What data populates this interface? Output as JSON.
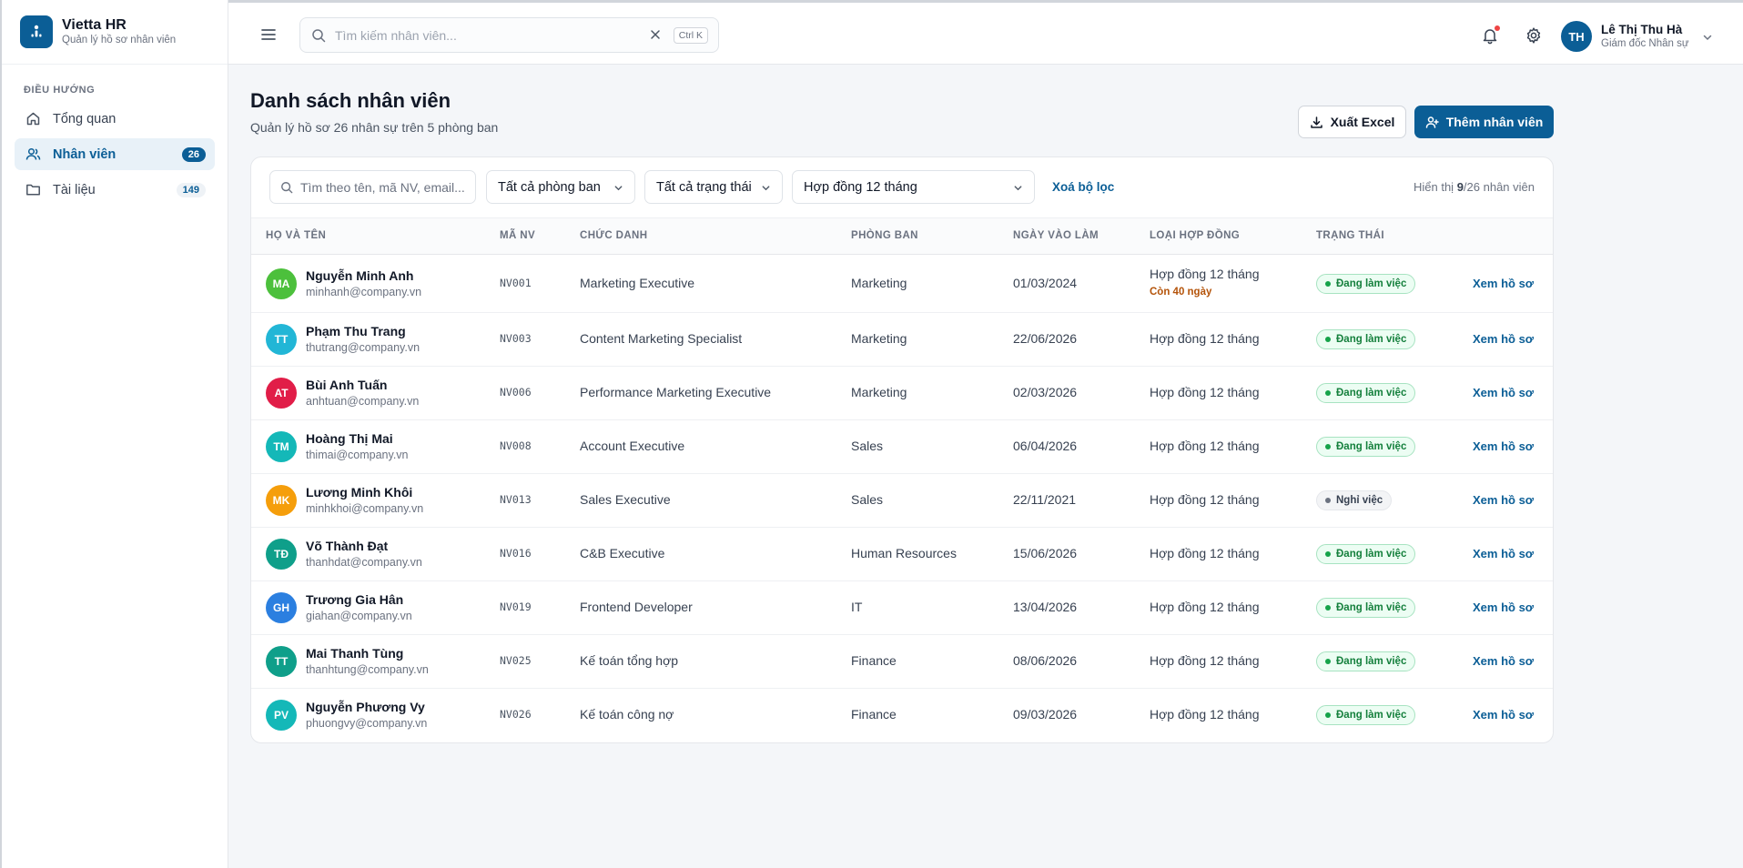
{
  "brand": {
    "title": "Vietta HR",
    "subtitle": "Quản lý hồ sơ nhân viên"
  },
  "nav": {
    "heading": "ĐIỀU HƯỚNG",
    "items": [
      {
        "label": "Tổng quan",
        "badge": "",
        "icon": "home-icon",
        "active": false
      },
      {
        "label": "Nhân viên",
        "badge": "26",
        "icon": "users-icon",
        "active": true
      },
      {
        "label": "Tài liệu",
        "badge": "149",
        "icon": "folder-icon",
        "active": false
      }
    ]
  },
  "topbar": {
    "search_placeholder": "Tìm kiếm nhân viên...",
    "shortcut": "Ctrl K",
    "user": {
      "initials": "TH",
      "name": "Lê Thị Thu Hà",
      "role": "Giám đốc Nhân sự"
    }
  },
  "page": {
    "title": "Danh sách nhân viên",
    "subtitle": "Quản lý hồ sơ 26 nhân sự trên 5 phòng ban",
    "export_label": "Xuất Excel",
    "add_label": "Thêm nhân viên"
  },
  "filters": {
    "search_placeholder": "Tìm theo tên, mã NV, email...",
    "department": "Tất cả phòng ban",
    "status": "Tất cả trạng thái",
    "contract": "Hợp đồng 12 tháng",
    "clear_label": "Xoá bộ lọc",
    "showing_prefix": "Hiển thị ",
    "showing_count": "9",
    "showing_suffix": "/26 nhân viên"
  },
  "table": {
    "headers": [
      "HỌ VÀ TÊN",
      "MÃ NV",
      "CHỨC DANH",
      "PHÒNG BAN",
      "NGÀY VÀO LÀM",
      "LOẠI HỢP ĐỒNG",
      "TRẠNG THÁI"
    ],
    "view_label": "Xem hồ sơ",
    "rows": [
      {
        "initials": "MA",
        "color": "#4cc03c",
        "name": "Nguyễn Minh Anh",
        "email": "minhanh@company.vn",
        "code": "NV001",
        "title": "Marketing Executive",
        "dept": "Marketing",
        "start": "01/03/2024",
        "contract": "Hợp đồng 12 tháng",
        "remaining": "Còn 40 ngày",
        "status": "Đang làm việc",
        "status_type": "active"
      },
      {
        "initials": "TT",
        "color": "#22b6d6",
        "name": "Phạm Thu Trang",
        "email": "thutrang@company.vn",
        "code": "NV003",
        "title": "Content Marketing Specialist",
        "dept": "Marketing",
        "start": "22/06/2026",
        "contract": "Hợp đồng 12 tháng",
        "remaining": "",
        "status": "Đang làm việc",
        "status_type": "active"
      },
      {
        "initials": "AT",
        "color": "#e11d48",
        "name": "Bùi Anh Tuấn",
        "email": "anhtuan@company.vn",
        "code": "NV006",
        "title": "Performance Marketing Executive",
        "dept": "Marketing",
        "start": "02/03/2026",
        "contract": "Hợp đồng 12 tháng",
        "remaining": "",
        "status": "Đang làm việc",
        "status_type": "active"
      },
      {
        "initials": "TM",
        "color": "#14b8b8",
        "name": "Hoàng Thị Mai",
        "email": "thimai@company.vn",
        "code": "NV008",
        "title": "Account Executive",
        "dept": "Sales",
        "start": "06/04/2026",
        "contract": "Hợp đồng 12 tháng",
        "remaining": "",
        "status": "Đang làm việc",
        "status_type": "active"
      },
      {
        "initials": "MK",
        "color": "#f59e0b",
        "name": "Lương Minh Khôi",
        "email": "minhkhoi@company.vn",
        "code": "NV013",
        "title": "Sales Executive",
        "dept": "Sales",
        "start": "22/11/2021",
        "contract": "Hợp đồng 12 tháng",
        "remaining": "",
        "status": "Nghỉ việc",
        "status_type": "inactive"
      },
      {
        "initials": "TĐ",
        "color": "#0f9f8a",
        "name": "Võ Thành Đạt",
        "email": "thanhdat@company.vn",
        "code": "NV016",
        "title": "C&B Executive",
        "dept": "Human Resources",
        "start": "15/06/2026",
        "contract": "Hợp đồng 12 tháng",
        "remaining": "",
        "status": "Đang làm việc",
        "status_type": "active"
      },
      {
        "initials": "GH",
        "color": "#2b7fe0",
        "name": "Trương Gia Hân",
        "email": "giahan@company.vn",
        "code": "NV019",
        "title": "Frontend Developer",
        "dept": "IT",
        "start": "13/04/2026",
        "contract": "Hợp đồng 12 tháng",
        "remaining": "",
        "status": "Đang làm việc",
        "status_type": "active"
      },
      {
        "initials": "TT",
        "color": "#0f9f8a",
        "name": "Mai Thanh Tùng",
        "email": "thanhtung@company.vn",
        "code": "NV025",
        "title": "Kế toán tổng hợp",
        "dept": "Finance",
        "start": "08/06/2026",
        "contract": "Hợp đồng 12 tháng",
        "remaining": "",
        "status": "Đang làm việc",
        "status_type": "active"
      },
      {
        "initials": "PV",
        "color": "#14b8b8",
        "name": "Nguyễn Phương Vy",
        "email": "phuongvy@company.vn",
        "code": "NV026",
        "title": "Kế toán công nợ",
        "dept": "Finance",
        "start": "09/03/2026",
        "contract": "Hợp đồng 12 tháng",
        "remaining": "",
        "status": "Đang làm việc",
        "status_type": "active"
      }
    ]
  },
  "colors": {
    "primary": "#0b5e96",
    "success": "#16a34a",
    "warning": "#b45309"
  }
}
